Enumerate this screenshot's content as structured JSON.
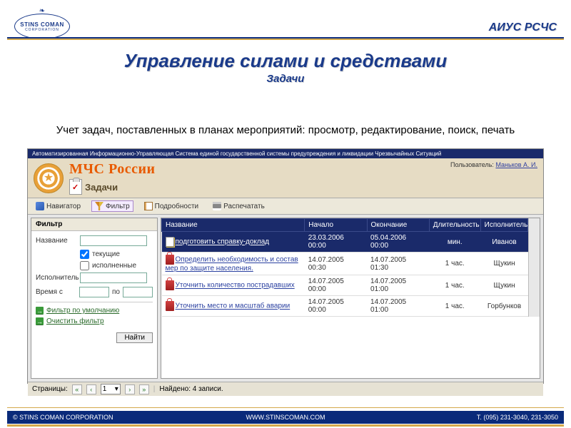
{
  "header": {
    "logo_text": "STINS COMAN",
    "logo_sub": "CORPORATION",
    "right_title": "АИУС РСЧС",
    "page_title": "Управление силами и средствами",
    "page_subtitle": "Задачи"
  },
  "description": "Учет задач, поставленных в планах мероприятий: просмотр, редактирование, поиск, печать",
  "app": {
    "top_bar": "Автоматизированная Информационно-Управляющая Система единой государственной системы предупреждения и ликвидации Чрезвычайных Ситуаций",
    "title_main": "МЧС России",
    "title_sub": "Задачи",
    "user_label": "Пользователь:",
    "user_name": "Маньков А. И.",
    "toolbar": {
      "nav": "Навигатор",
      "filter": "Фильтр",
      "details": "Подробности",
      "print": "Распечатать"
    },
    "filter_panel": {
      "title": "Фильтр",
      "name_label": "Название",
      "chk_current": "текущие",
      "chk_done": "исполненные",
      "executor_label": "Исполнитель",
      "time_label": "Время с",
      "time_to": "по",
      "link_default": "Фильтр по умолчанию",
      "link_clear": "Очистить фильтр",
      "find_btn": "Найти"
    },
    "grid": {
      "columns": [
        "Название",
        "Начало",
        "Окончание",
        "Длительность",
        "Исполнитель"
      ],
      "rows": [
        {
          "selected": true,
          "icon": "doc",
          "name": "подготовить справку-доклад",
          "start": "23.03.2006 00:00",
          "end": "05.04.2006 00:00",
          "dur": "мин.",
          "exec": "Иванов"
        },
        {
          "selected": false,
          "icon": "lock",
          "name": "Определить необходимость и состав мер по защите населения.",
          "start": "14.07.2005 00:30",
          "end": "14.07.2005 01:30",
          "dur": "1 час.",
          "exec": "Щукин"
        },
        {
          "selected": false,
          "icon": "lock",
          "name": "Уточнить количество пострадавших",
          "start": "14.07.2005 00:00",
          "end": "14.07.2005 01:00",
          "dur": "1 час.",
          "exec": "Щукин"
        },
        {
          "selected": false,
          "icon": "lock",
          "name": "Уточнить место и масштаб аварии",
          "start": "14.07.2005 00:00",
          "end": "14.07.2005 01:00",
          "dur": "1 час.",
          "exec": "Горбунков"
        }
      ]
    },
    "status": {
      "pages_label": "Страницы:",
      "page_sel": "1",
      "found": "Найдено: 4 записи."
    }
  },
  "footer": {
    "left": "© STINS COMAN CORPORATION",
    "mid": "WWW.STINSCOMAN.COM",
    "right": "Т. (095) 231-3040, 231-3050"
  }
}
